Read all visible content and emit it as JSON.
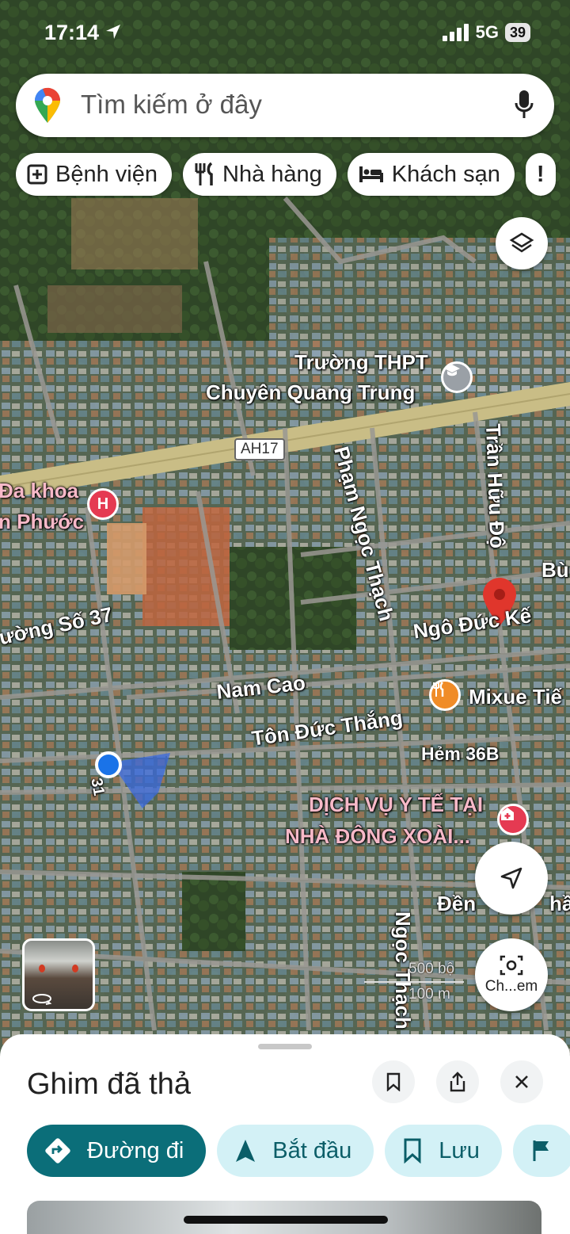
{
  "status_bar": {
    "time": "17:14",
    "network": "5G",
    "battery": "39"
  },
  "search": {
    "placeholder": "Tìm kiếm ở đây"
  },
  "chips": [
    {
      "label": "Bệnh viện",
      "icon": "hospital-plus-icon"
    },
    {
      "label": "Nhà hàng",
      "icon": "restaurant-icon"
    },
    {
      "label": "Khách sạn",
      "icon": "bed-icon"
    }
  ],
  "map": {
    "labels": {
      "school_line1": "Trường THPT",
      "school_line2": "Chuyên Quang Trung",
      "highway": "AH17",
      "hospital_line1": "Đa khoa",
      "hospital_line2": "n Phước",
      "street_so37": "ường Số 37",
      "pham_ngoc_thach": "Phạm Ngọc Thạch",
      "tran_huu_do": "Trần Hữu Độ",
      "bui": "Bù",
      "ngo_duc_ke": "Ngô Đức Kế",
      "nam_cao": "Nam Cao",
      "ton_duc_thang": "Tôn Đức Thắng",
      "mixue": "Mixue Tiế",
      "hem_36b": "Hẻm 36B",
      "road_31": "31",
      "dich_vu_line1": "DỊCH VỤ Y TẾ TẠI",
      "dich_vu_line2": "NHÀ ĐÔNG XOÀI...",
      "den": "Đền",
      "den_tail": "hầ",
      "ngoc_thach_2": "Ngọc Thạch",
      "scale_ft": "500 bộ",
      "scale_m": "100 m"
    },
    "camera_label": "Ch...em"
  },
  "sheet": {
    "title": "Ghim đã thả",
    "actions": [
      {
        "label": "Đường đi",
        "icon": "directions-icon"
      },
      {
        "label": "Bắt đầu",
        "icon": "navigate-arrow-icon"
      },
      {
        "label": "Lưu",
        "icon": "bookmark-icon"
      }
    ]
  },
  "colors": {
    "primary": "#0b6e79",
    "secondary_bg": "#d3f1f6",
    "pin": "#e0362c",
    "location_dot": "#1a73e8"
  }
}
